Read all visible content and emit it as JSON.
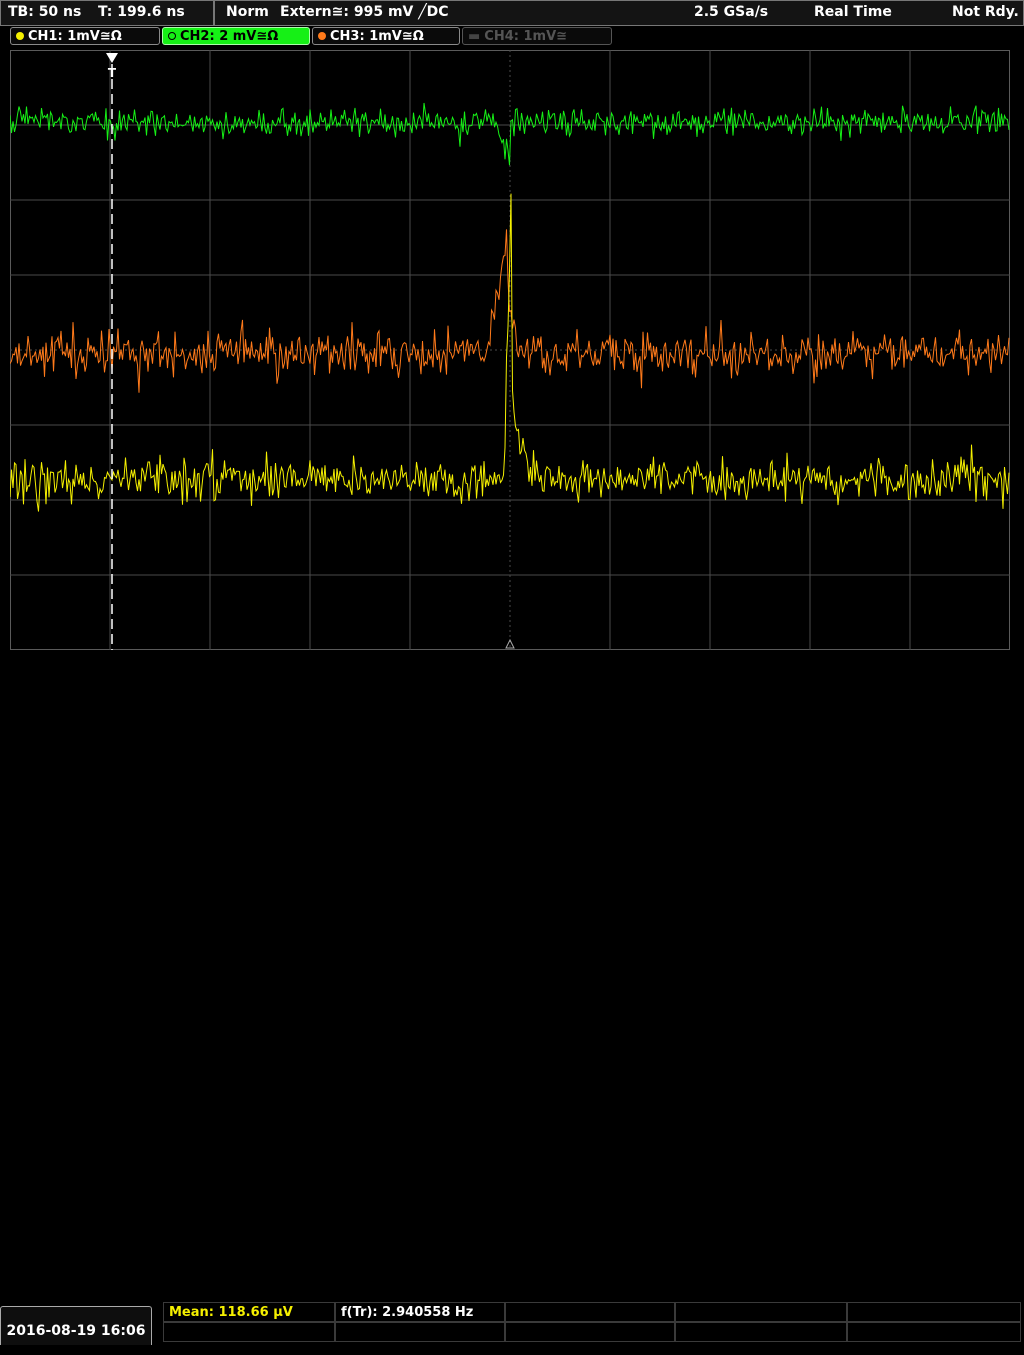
{
  "header": {
    "timebase": "TB: 50 ns",
    "trigger_time": "T: 199.6 ns",
    "acq_mode": "Norm",
    "trigger_source": "Extern≅: 995 mV ╱DC",
    "sample_rate": "2.5 GSa/s",
    "realtime": "Real Time",
    "status": "Not Rdy."
  },
  "channels": [
    {
      "label": "CH1: 1mV≅Ω",
      "color": "#f5f000",
      "active": false,
      "enabled": true
    },
    {
      "label": "CH2: 2 mV≅Ω",
      "color": "#16f016",
      "active": true,
      "enabled": true
    },
    {
      "label": "CH3: 1mV≅Ω",
      "color": "#ff7a1a",
      "active": false,
      "enabled": true
    },
    {
      "label": "CH4: 1mV≅",
      "color": "#555555",
      "active": false,
      "enabled": false
    }
  ],
  "trigger_marker": "T",
  "footer": {
    "datetime": "2016-08-19 16:06",
    "mean": "Mean: 118.66 µV",
    "freq": "f(Tr): 2.940558 Hz"
  },
  "colors": {
    "ch1": "#f5f000",
    "ch2": "#16f016",
    "ch3": "#ff7a1a",
    "grid": "#4a4a4a",
    "meas_yellow": "#f5f000"
  }
}
